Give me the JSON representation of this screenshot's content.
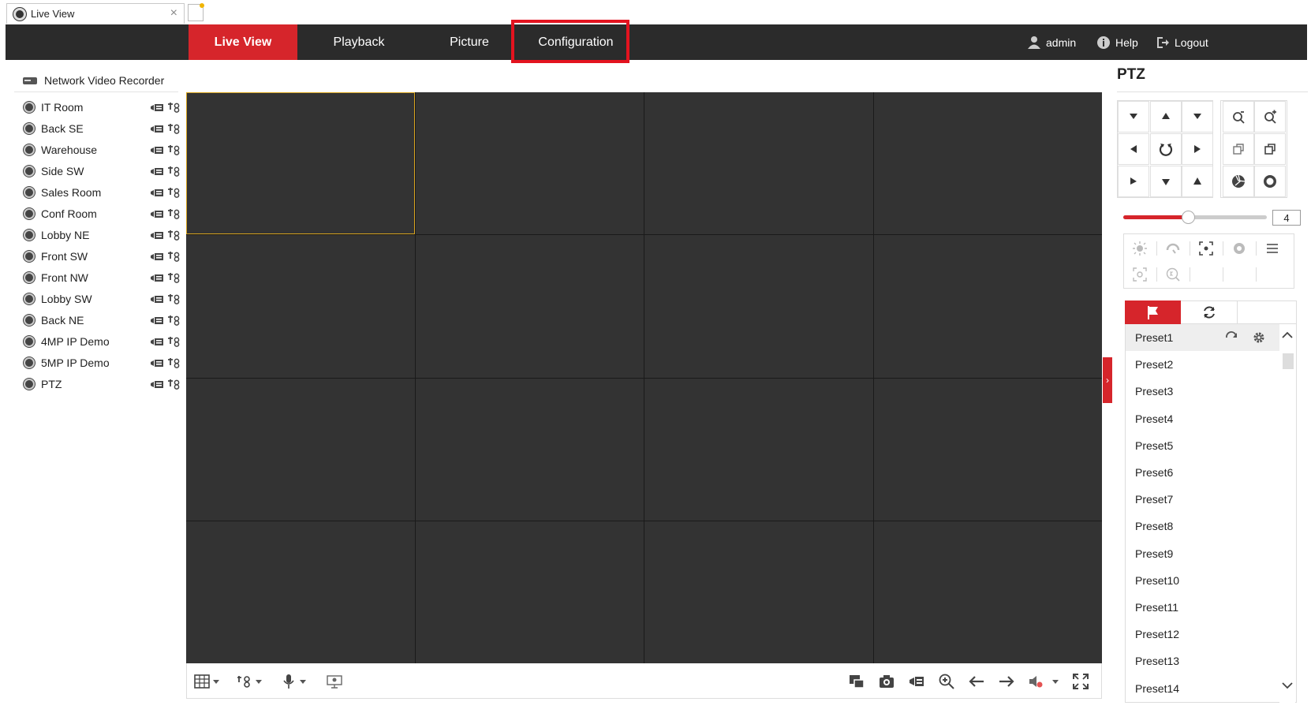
{
  "browser": {
    "tab_title": "Live View",
    "close_glyph": "×"
  },
  "nav": {
    "live_view": "Live View",
    "playback": "Playback",
    "picture": "Picture",
    "configuration": "Configuration",
    "user": "admin",
    "help": "Help",
    "logout": "Logout"
  },
  "tree": {
    "header": "Network Video Recorder",
    "cameras": [
      "IT Room",
      "Back SE",
      "Warehouse",
      "Side SW",
      "Sales Room",
      "Conf Room",
      "Lobby NE",
      "Front SW",
      "Front NW",
      "Lobby SW",
      "Back NE",
      "4MP IP Demo",
      "5MP IP Demo",
      "PTZ"
    ]
  },
  "ptz": {
    "title": "PTZ",
    "speed": "4",
    "speed_fraction": 0.45,
    "expand_glyph": "›",
    "presets": [
      "Preset1",
      "Preset2",
      "Preset3",
      "Preset4",
      "Preset5",
      "Preset6",
      "Preset7",
      "Preset8",
      "Preset9",
      "Preset10",
      "Preset11",
      "Preset12",
      "Preset13",
      "Preset14"
    ]
  },
  "colors": {
    "accent": "#d6252b",
    "nav_bg": "#2b2b2b",
    "cell_bg": "#333333",
    "selected_cell": "#d9a520",
    "highlight_box": "#e3131f"
  }
}
